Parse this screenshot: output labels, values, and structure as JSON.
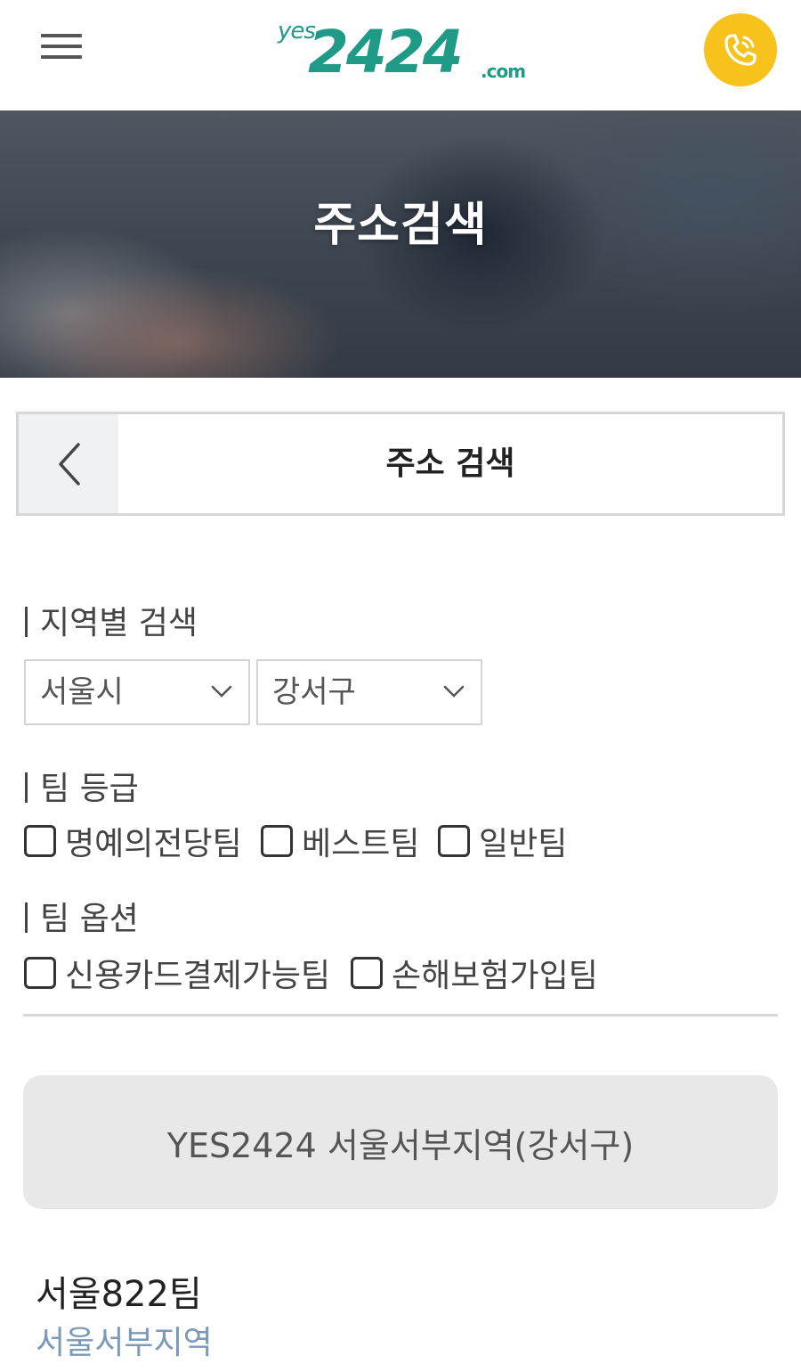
{
  "header": {
    "logo": {
      "prefix": "yes",
      "number": "2424",
      "suffix": ".com"
    },
    "menu_icon": "hamburger-menu-icon",
    "call_icon": "phone-icon",
    "colors": {
      "brand": "#1e9a87",
      "call_button": "#f7c21c"
    }
  },
  "hero": {
    "title": "주소검색"
  },
  "titlebar": {
    "back_icon": "chevron-left-icon",
    "title": "주소 검색"
  },
  "region_search": {
    "label": "지역별 검색",
    "city": "서울시",
    "district": "강서구"
  },
  "team_grade": {
    "label": "팀 등급",
    "options": [
      {
        "label": "명예의전당팀",
        "checked": false
      },
      {
        "label": "베스트팀",
        "checked": false
      },
      {
        "label": "일반팀",
        "checked": false
      }
    ]
  },
  "team_option": {
    "label": "팀 옵션",
    "options": [
      {
        "label": "신용카드결제가능팀",
        "checked": false
      },
      {
        "label": "손해보험가입팀",
        "checked": false
      }
    ]
  },
  "region_result": {
    "label": "YES2424 서울서부지역(강서구)"
  },
  "team": {
    "name": "서울822팀",
    "region": "서울서부지역"
  }
}
